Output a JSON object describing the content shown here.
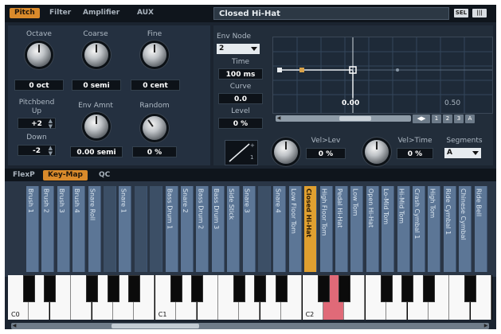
{
  "tabs": [
    "Pitch",
    "Filter",
    "Amplifier",
    "AUX"
  ],
  "active_tab": "Pitch",
  "preset_name": "Closed Hi-Hat",
  "top_icons": [
    "SEL",
    "|||"
  ],
  "pitch": {
    "octave": {
      "label": "Octave",
      "value": "0 oct"
    },
    "coarse": {
      "label": "Coarse",
      "value": "0 semi"
    },
    "fine": {
      "label": "Fine",
      "value": "0 cent"
    },
    "pitchbend_label": "Pitchbend",
    "up": {
      "label": "Up",
      "value": "+2"
    },
    "down": {
      "label": "Down",
      "value": "-2"
    },
    "env_amnt": {
      "label": "Env Amnt",
      "value": "0.00 semi"
    },
    "random": {
      "label": "Random",
      "value": "0 %"
    }
  },
  "envelope": {
    "env_node_label": "Env Node",
    "env_node_value": "2",
    "time_label": "Time",
    "time_value": "100 ms",
    "curve_label": "Curve",
    "curve_value": "0.0",
    "level_label": "Level",
    "level_value": "0 %",
    "graph_marker_left": "0.00",
    "graph_marker_right": "0.50",
    "graph_buttons": [
      "1",
      "2",
      "3",
      "A"
    ],
    "curve_glyphs": [
      "+",
      "1"
    ]
  },
  "velocity": {
    "vel_lev_label": "Vel>Lev",
    "vel_lev_value": "0 %",
    "vel_time_label": "Vel>Time",
    "vel_time_value": "0 %",
    "segments_label": "Segments",
    "segments_value": "A"
  },
  "sub_tabs": [
    "FlexP",
    "Key-Map",
    "QC"
  ],
  "active_sub_tab": "Key-Map",
  "slots": [
    "Brush 1",
    "Brush 2",
    "Brush 3",
    "Brush 4",
    "Snare Roll",
    "",
    "Snare 1",
    "",
    "",
    "Bass Drum 1",
    "Snare 2",
    "Bass Drum 2",
    "Bass Drum 3",
    "Side Stick",
    "Snare 3",
    "",
    "Snare 4",
    "Low Floor Tom",
    "Closed Hi-Hat",
    "High Floor Tom",
    "Pedal Hi-Hat",
    "Low Tom",
    "Open Hi-Hat",
    "Lo-Mid Tom",
    "Hi-Mid Tom",
    "Crash Cymbal 1",
    "High Tom",
    "Ride Cymbal 1",
    "Chinese Cymbal",
    "Ride Bell"
  ],
  "selected_slot": "Closed Hi-Hat",
  "keyboard": {
    "labels": [
      "C0",
      "C1",
      "C2"
    ],
    "highlight_key": "C2+1 white"
  },
  "colors": {
    "accent": "#d98a2b",
    "slot": "#5c7696",
    "slot_selected": "#e0a030",
    "key_highlight": "#e06a78",
    "background": "#1b2430"
  }
}
